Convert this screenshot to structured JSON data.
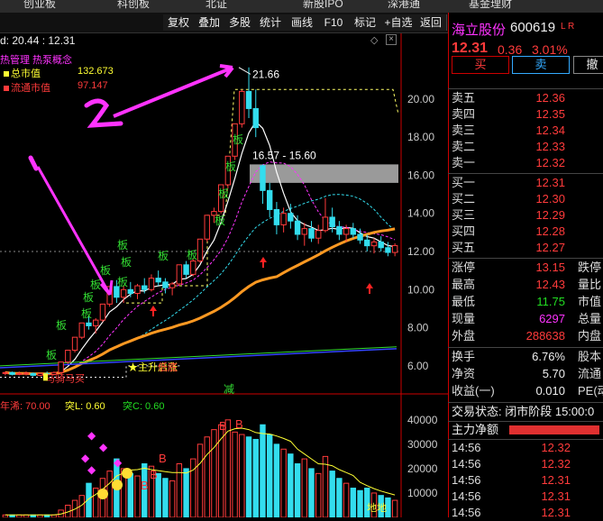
{
  "top_tabs": [
    "创业板",
    "科创板",
    "北证",
    "新股IPO",
    "深港通",
    "基金理财"
  ],
  "toolbar": {
    "buttons": [
      "复权",
      "叠加",
      "多股",
      "统计",
      "画线",
      "F10",
      "标记",
      "+自选",
      "返回"
    ]
  },
  "chart": {
    "header_text": "d: 20.44 : 12.31",
    "concepts": "热管理  热泵概念",
    "total_mv_label": "总市值",
    "total_mv_value": "132.673",
    "float_mv_label": "流通市值",
    "float_mv_value": "97.147",
    "high_label": "21.66",
    "range_label": "16.57 - 15.60",
    "y_ticks": [
      "20.00",
      "18.00",
      "16.00",
      "14.00",
      "12.00",
      "10.00",
      "8.00",
      "6.00"
    ],
    "board_tag": "板",
    "signal_main": "主升启涨",
    "signal_buy": "马骑马买",
    "signal_low": "低底",
    "cut_tag": "减",
    "indicator_line": {
      "a_label": "年浠: 70.00",
      "b_label": "突L: 0.60",
      "c_label": "突C: 0.60"
    },
    "vol_ticks": [
      "40000",
      "30000",
      "20000",
      "10000"
    ],
    "b_tag": "B",
    "dr_tag": "地地"
  },
  "quote": {
    "name": "海立股份",
    "code": "600619",
    "flags": "L R",
    "price": "12.31",
    "change": "0.36",
    "change_pct": "3.01%",
    "buy_label": "买",
    "sell_label": "卖",
    "cancel_label": "撤",
    "asks": [
      {
        "label": "卖五",
        "price": "12.36"
      },
      {
        "label": "卖四",
        "price": "12.35"
      },
      {
        "label": "卖三",
        "price": "12.34"
      },
      {
        "label": "卖二",
        "price": "12.33"
      },
      {
        "label": "卖一",
        "price": "12.32"
      }
    ],
    "bids": [
      {
        "label": "买一",
        "price": "12.31"
      },
      {
        "label": "买二",
        "price": "12.30"
      },
      {
        "label": "买三",
        "price": "12.29"
      },
      {
        "label": "买四",
        "price": "12.28"
      },
      {
        "label": "买五",
        "price": "12.27"
      }
    ],
    "stats_left": [
      {
        "label": "涨停",
        "value": "13.15",
        "color": "red"
      },
      {
        "label": "最高",
        "value": "12.43",
        "color": "red"
      },
      {
        "label": "最低",
        "value": "11.75",
        "color": "grn"
      },
      {
        "label": "现量",
        "value": "6297",
        "color": "mag"
      },
      {
        "label": "外盘",
        "value": "288638",
        "color": "red"
      }
    ],
    "stats_right": [
      "跌停",
      "量比",
      "市值",
      "总量",
      "内盘"
    ],
    "stats2": [
      {
        "label": "换手",
        "value": "6.76%",
        "right": "股本"
      },
      {
        "label": "净资",
        "value": "5.70",
        "right": "流通"
      },
      {
        "label": "收益(一)",
        "value": "0.010",
        "right": "PE(动"
      }
    ],
    "trade_status": "交易状态: 闭市阶段 15:00:0",
    "net_flow_label": "主力净额",
    "ticks": [
      {
        "time": "14:56",
        "price": "12.32"
      },
      {
        "time": "14:56",
        "price": "12.32"
      },
      {
        "time": "14:56",
        "price": "12.31"
      },
      {
        "time": "14:56",
        "price": "12.31"
      },
      {
        "time": "14:56",
        "price": "12.31"
      }
    ]
  },
  "candles": [
    [
      5.6,
      5.7,
      5.5,
      5.65
    ],
    [
      5.65,
      5.7,
      5.5,
      5.55
    ],
    [
      5.55,
      5.7,
      5.5,
      5.6
    ],
    [
      5.6,
      5.7,
      5.5,
      5.62
    ],
    [
      5.6,
      5.65,
      5.45,
      5.5
    ],
    [
      5.5,
      5.65,
      5.45,
      5.6
    ],
    [
      5.6,
      5.7,
      5.5,
      5.55
    ],
    [
      5.55,
      5.7,
      5.5,
      5.65
    ],
    [
      5.65,
      6.2,
      5.6,
      6.2
    ],
    [
      6.2,
      6.82,
      6.1,
      6.82
    ],
    [
      6.82,
      7.5,
      6.7,
      7.5
    ],
    [
      7.5,
      8.25,
      7.4,
      8.25
    ],
    [
      8.25,
      8.6,
      7.9,
      8.1
    ],
    [
      8.1,
      8.5,
      7.7,
      8.4
    ],
    [
      8.4,
      9.24,
      8.3,
      9.24
    ],
    [
      9.24,
      10.16,
      9.1,
      10.16
    ],
    [
      10.16,
      10.5,
      9.3,
      9.6
    ],
    [
      9.6,
      10.2,
      9.3,
      10.0
    ],
    [
      10.0,
      10.4,
      9.6,
      9.8
    ],
    [
      9.8,
      10.3,
      9.5,
      10.2
    ],
    [
      10.2,
      10.6,
      9.8,
      10.0
    ],
    [
      10.0,
      10.8,
      9.9,
      10.6
    ],
    [
      10.6,
      11.0,
      10.2,
      10.4
    ],
    [
      10.4,
      10.6,
      9.8,
      10.1
    ],
    [
      10.1,
      10.4,
      9.7,
      10.3
    ],
    [
      10.3,
      11.3,
      10.2,
      11.3
    ],
    [
      11.3,
      11.5,
      10.6,
      10.8
    ],
    [
      10.8,
      11.6,
      10.7,
      11.5
    ],
    [
      11.5,
      12.65,
      11.4,
      12.65
    ],
    [
      12.65,
      13.9,
      12.5,
      13.9
    ],
    [
      13.9,
      14.3,
      13.5,
      14.1
    ],
    [
      14.1,
      15.5,
      14.0,
      15.5
    ],
    [
      15.5,
      17.0,
      15.3,
      17.0
    ],
    [
      17.0,
      18.7,
      16.8,
      18.7
    ],
    [
      18.7,
      20.5,
      18.5,
      20.4
    ],
    [
      20.4,
      21.66,
      19.0,
      19.5
    ],
    [
      19.5,
      20.5,
      18.0,
      18.5
    ],
    [
      16.5,
      16.57,
      14.5,
      15.2
    ],
    [
      15.2,
      15.6,
      13.8,
      14.2
    ],
    [
      14.2,
      14.6,
      12.9,
      13.4
    ],
    [
      13.4,
      14.3,
      13.0,
      14.0
    ],
    [
      14.0,
      14.5,
      13.2,
      13.6
    ],
    [
      13.6,
      13.9,
      12.6,
      12.9
    ],
    [
      12.9,
      13.5,
      12.3,
      13.2
    ],
    [
      13.2,
      13.6,
      12.5,
      12.7
    ],
    [
      12.7,
      13.4,
      12.4,
      13.1
    ],
    [
      13.1,
      14.8,
      13.0,
      13.8
    ],
    [
      13.8,
      14.3,
      13.0,
      13.3
    ],
    [
      13.3,
      13.6,
      12.6,
      12.9
    ],
    [
      12.9,
      13.4,
      12.5,
      13.2
    ],
    [
      13.2,
      13.5,
      12.7,
      12.9
    ],
    [
      12.9,
      13.2,
      12.4,
      12.6
    ],
    [
      12.6,
      12.9,
      12.0,
      12.3
    ],
    [
      12.3,
      12.7,
      11.9,
      12.5
    ],
    [
      12.5,
      12.8,
      12.0,
      12.2
    ],
    [
      12.2,
      12.5,
      11.75,
      11.95
    ],
    [
      11.95,
      12.43,
      11.75,
      12.31
    ]
  ],
  "volumes": [
    1,
    1,
    1,
    1,
    1,
    1,
    1,
    1,
    3,
    5,
    7,
    9,
    14,
    12,
    16,
    19,
    24,
    20,
    18,
    17,
    22,
    21,
    18,
    16,
    15,
    22,
    20,
    24,
    30,
    33,
    36,
    38,
    40,
    35,
    34,
    33,
    32,
    38,
    34,
    30,
    28,
    26,
    22,
    24,
    20,
    18,
    25,
    19,
    16,
    14,
    12,
    11,
    12,
    10,
    9,
    8,
    7
  ]
}
